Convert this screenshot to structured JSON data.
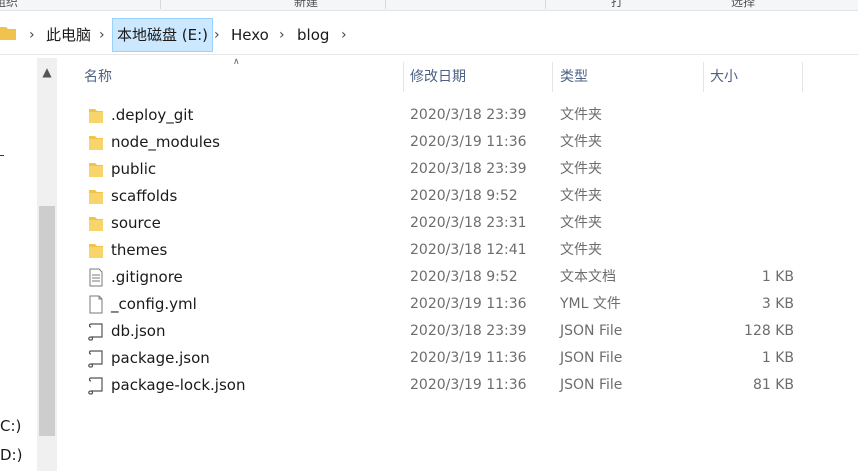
{
  "ribbon": {
    "labels": [
      "组织",
      "新建",
      "打开",
      "选择"
    ]
  },
  "address": {
    "crumbs": [
      "此电脑",
      "本地磁盘 (E:)",
      "Hexo",
      "blog"
    ],
    "active_index": 1
  },
  "nav": {
    "drives": [
      "C:)",
      "D:)"
    ]
  },
  "columns": {
    "name": "名称",
    "date": "修改日期",
    "type": "类型",
    "size": "大小"
  },
  "files": [
    {
      "name": ".deploy_git",
      "date": "2020/3/18 23:39",
      "type": "文件夹",
      "size": "",
      "icon": "folder-icon"
    },
    {
      "name": "node_modules",
      "date": "2020/3/19 11:36",
      "type": "文件夹",
      "size": "",
      "icon": "folder-icon"
    },
    {
      "name": "public",
      "date": "2020/3/18 23:39",
      "type": "文件夹",
      "size": "",
      "icon": "folder-icon"
    },
    {
      "name": "scaffolds",
      "date": "2020/3/18 9:52",
      "type": "文件夹",
      "size": "",
      "icon": "folder-icon"
    },
    {
      "name": "source",
      "date": "2020/3/18 23:31",
      "type": "文件夹",
      "size": "",
      "icon": "folder-icon"
    },
    {
      "name": "themes",
      "date": "2020/3/18 12:41",
      "type": "文件夹",
      "size": "",
      "icon": "folder-icon"
    },
    {
      "name": ".gitignore",
      "date": "2020/3/18 9:52",
      "type": "文本文档",
      "size": "1 KB",
      "icon": "text-file-icon"
    },
    {
      "name": "_config.yml",
      "date": "2020/3/19 11:36",
      "type": "YML 文件",
      "size": "3 KB",
      "icon": "document-file-icon"
    },
    {
      "name": "db.json",
      "date": "2020/3/18 23:39",
      "type": "JSON File",
      "size": "128 KB",
      "icon": "json-file-icon"
    },
    {
      "name": "package.json",
      "date": "2020/3/19 11:36",
      "type": "JSON File",
      "size": "1 KB",
      "icon": "json-file-icon"
    },
    {
      "name": "package-lock.json",
      "date": "2020/3/19 11:36",
      "type": "JSON File",
      "size": "81 KB",
      "icon": "json-file-icon"
    }
  ],
  "colors": {
    "folder": "#f0c44c",
    "header_text": "#4d6185",
    "active_crumb_bg": "#cce8ff",
    "meta_text": "#6d6d6d"
  }
}
